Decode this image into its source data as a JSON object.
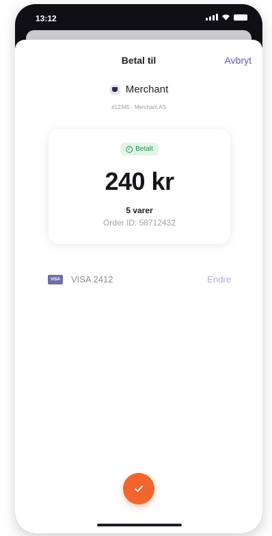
{
  "status_bar": {
    "time": "13:12"
  },
  "header": {
    "title": "Betal til",
    "cancel_label": "Avbryt"
  },
  "merchant": {
    "name": "Merchant",
    "subtitle": "#12345 - Merchant AS"
  },
  "order": {
    "status_label": "Betalt",
    "amount": "240 kr",
    "items_count": "5 varer",
    "order_id": "Order ID: 58712432"
  },
  "payment_method": {
    "brand": "VISA",
    "label": "VISA 2412",
    "change_label": "Endre"
  },
  "colors": {
    "accent": "#6a56c8",
    "confirm": "#f2662e",
    "success_bg": "#e2f5e8",
    "success_text": "#2a8a4c"
  },
  "icons": {
    "merchant": "merchant-icon",
    "status": "check-circle-icon",
    "card": "visa-card-icon",
    "confirm": "checkmark-icon"
  }
}
